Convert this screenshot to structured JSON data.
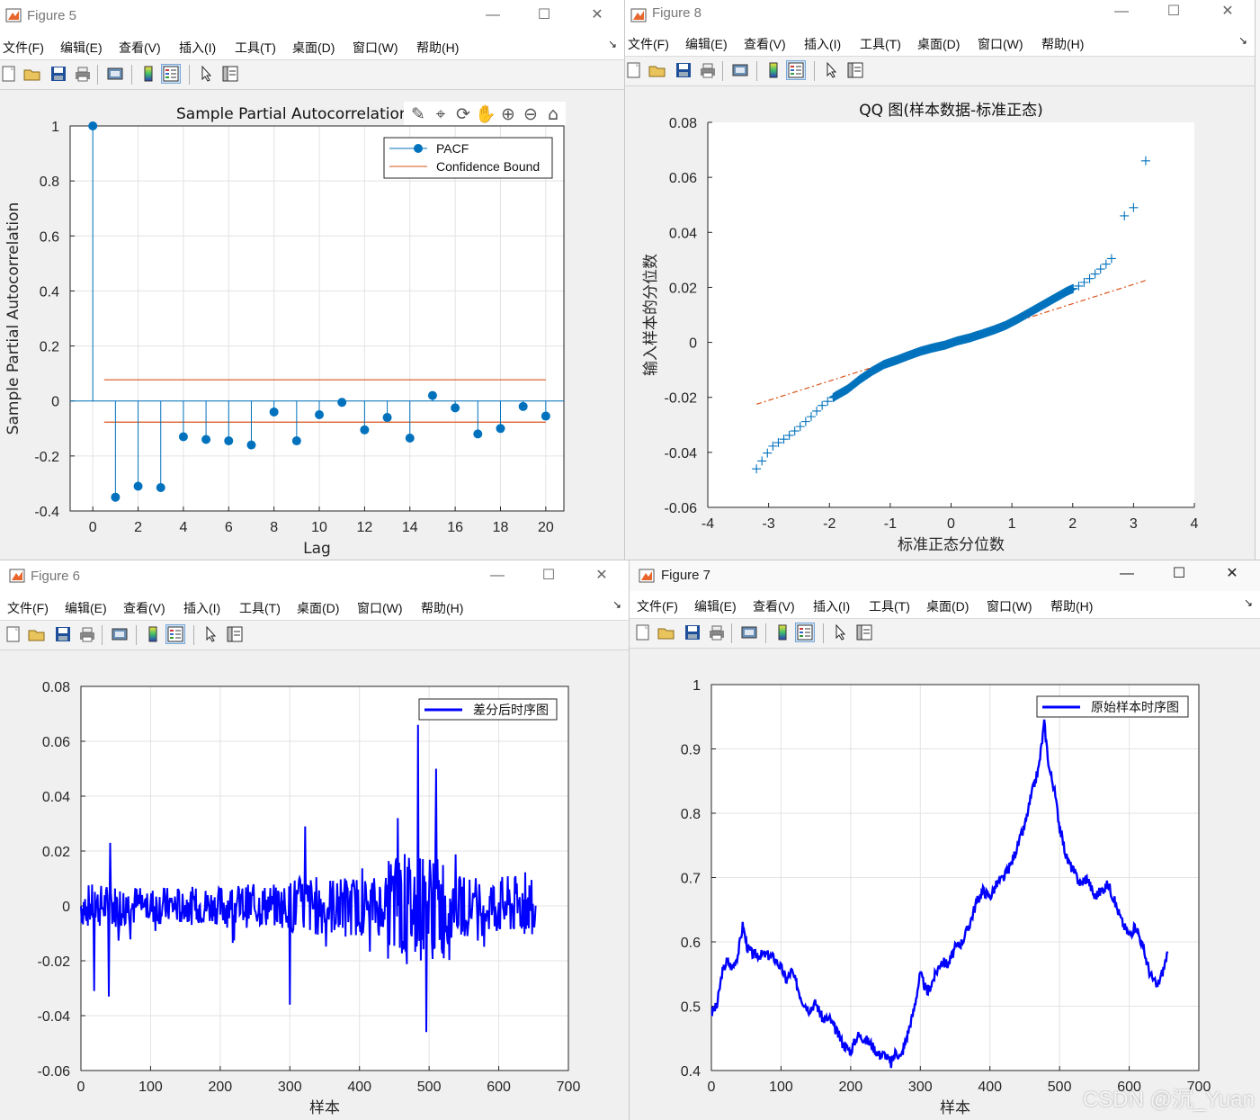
{
  "menu": [
    "文件(F)",
    "编辑(E)",
    "查看(V)",
    "插入(I)",
    "工具(T)",
    "桌面(D)",
    "窗口(W)",
    "帮助(H)"
  ],
  "window_controls": {
    "minimize": "—",
    "maximize": "☐",
    "close": "✕"
  },
  "watermark": "CSDN @沉_Yuan",
  "colors": {
    "stem": "#0072BD",
    "bound": "#D95319",
    "qq_marker": "#0072BD",
    "qq_line": "#D95319",
    "series": "#0000FF"
  },
  "icons": [
    "new-figure-icon",
    "open-icon",
    "save-icon",
    "print-icon",
    "print-preview-icon",
    "colorbar-icon",
    "legend-icon",
    "pointer-icon",
    "property-editor-icon"
  ],
  "figure5": {
    "title": "Figure 5",
    "axes_toolbar_icons": [
      "brush-icon",
      "data-tip-icon",
      "rotate-icon",
      "pan-icon",
      "zoom-in-icon",
      "zoom-out-icon",
      "home-icon"
    ],
    "chart_data": {
      "type": "stem",
      "title": "Sample Partial Autocorrelation F",
      "xlabel": "Lag",
      "ylabel": "Sample Partial Autocorrelation",
      "xlim": [
        -1,
        20.8
      ],
      "ylim": [
        -0.4,
        1
      ],
      "xticks": [
        "0",
        "2",
        "4",
        "6",
        "8",
        "10",
        "12",
        "14",
        "16",
        "18",
        "20"
      ],
      "yticks": [
        "1",
        "0.8",
        "0.6",
        "0.4",
        "0.2",
        "0",
        "-0.2",
        "-0.4"
      ],
      "grid": true,
      "legend": {
        "position": "top-right",
        "entries": [
          "PACF",
          "Confidence Bound"
        ]
      },
      "series": [
        {
          "name": "PACF",
          "x": [
            0,
            1,
            2,
            3,
            4,
            5,
            6,
            7,
            8,
            9,
            10,
            11,
            12,
            13,
            14,
            15,
            16,
            17,
            18,
            19,
            20
          ],
          "values": [
            1,
            -0.35,
            -0.31,
            -0.315,
            -0.13,
            -0.14,
            -0.145,
            -0.16,
            -0.04,
            -0.145,
            -0.05,
            -0.005,
            -0.105,
            -0.06,
            -0.135,
            0.02,
            -0.025,
            -0.12,
            -0.1,
            -0.02,
            -0.055
          ]
        },
        {
          "name": "Confidence Bound",
          "upper": 0.077,
          "lower": -0.077,
          "x_range": [
            0.5,
            20
          ]
        }
      ]
    }
  },
  "figure8": {
    "title": "Figure 8",
    "chart_data": {
      "type": "scatter",
      "title": "QQ 图(样本数据-标准正态)",
      "xlabel": "标准正态分位数",
      "ylabel": "输入样本的分位数",
      "xlim": [
        -4,
        4
      ],
      "ylim": [
        -0.06,
        0.08
      ],
      "xticks": [
        "-4",
        "-3",
        "-2",
        "-1",
        "0",
        "1",
        "2",
        "3",
        "4"
      ],
      "yticks": [
        "0.08",
        "0.06",
        "0.04",
        "0.02",
        "0",
        "-0.02",
        "-0.04",
        "-0.06"
      ],
      "grid": false,
      "reference_line": {
        "x": [
          -3.2,
          3.2
        ],
        "y": [
          -0.0225,
          0.0225
        ]
      },
      "quantile_curve": {
        "x": [
          -3.2,
          -2.95,
          -2.7,
          -2.5,
          -2.3,
          -2.1,
          -1.9,
          -1.7,
          -1.5,
          -1.3,
          -1.1,
          -0.9,
          -0.7,
          -0.5,
          -0.3,
          -0.1,
          0.1,
          0.3,
          0.5,
          0.7,
          0.9,
          1.1,
          1.3,
          1.5,
          1.7,
          1.9,
          2.1,
          2.3,
          2.5,
          2.6,
          2.7,
          2.85,
          3.2
        ],
        "y": [
          -0.046,
          -0.038,
          -0.0345,
          -0.031,
          -0.027,
          -0.0225,
          -0.0195,
          -0.017,
          -0.0135,
          -0.0105,
          -0.008,
          -0.0065,
          -0.0048,
          -0.0032,
          -0.002,
          -0.001,
          0.0005,
          0.0016,
          0.003,
          0.0045,
          0.0062,
          0.0085,
          0.011,
          0.0135,
          0.016,
          0.0185,
          0.0205,
          0.0235,
          0.0275,
          0.0295,
          0.032,
          0.046,
          0.066
        ],
        "extra_points": [
          {
            "x": 2.85,
            "y": 0.046
          },
          {
            "x": 3.0,
            "y": 0.049
          },
          {
            "x": 3.2,
            "y": 0.066
          }
        ]
      }
    }
  },
  "figure6": {
    "title": "Figure 6",
    "chart_data": {
      "type": "line",
      "xlabel": "样本",
      "ylabel": "",
      "xlim": [
        0,
        700
      ],
      "ylim": [
        -0.06,
        0.08
      ],
      "xticks": [
        "0",
        "100",
        "200",
        "300",
        "400",
        "500",
        "600",
        "700"
      ],
      "yticks": [
        "0.08",
        "0.06",
        "0.04",
        "0.02",
        "0",
        "-0.02",
        "-0.04",
        "-0.06"
      ],
      "grid": true,
      "legend": {
        "position": "top-right",
        "entries": [
          "差分后时序图"
        ]
      },
      "series": [
        {
          "name": "差分后时序图",
          "n": 654,
          "range": [
            -0.046,
            0.066
          ],
          "notable_points": [
            {
              "x": 19,
              "y": -0.031
            },
            {
              "x": 40,
              "y": -0.033
            },
            {
              "x": 42,
              "y": 0.023
            },
            {
              "x": 300,
              "y": -0.036
            },
            {
              "x": 322,
              "y": 0.029
            },
            {
              "x": 455,
              "y": 0.032
            },
            {
              "x": 484,
              "y": 0.066
            },
            {
              "x": 496,
              "y": -0.046
            },
            {
              "x": 510,
              "y": 0.05
            }
          ]
        }
      ]
    }
  },
  "figure7": {
    "title": "Figure 7",
    "chart_data": {
      "type": "line",
      "xlabel": "样本",
      "ylabel": "",
      "xlim": [
        0,
        700
      ],
      "ylim": [
        0.4,
        1
      ],
      "xticks": [
        "0",
        "100",
        "200",
        "300",
        "400",
        "500",
        "600",
        "700"
      ],
      "yticks": [
        "1",
        "0.9",
        "0.8",
        "0.7",
        "0.6",
        "0.5",
        "0.4"
      ],
      "grid": true,
      "legend": {
        "position": "top-right",
        "entries": [
          "原始样本时序图"
        ]
      },
      "series": [
        {
          "name": "原始样本时序图",
          "x": [
            0,
            8,
            15,
            22,
            30,
            38,
            45,
            52,
            60,
            70,
            80,
            90,
            100,
            108,
            115,
            122,
            130,
            140,
            150,
            160,
            170,
            180,
            190,
            200,
            210,
            220,
            230,
            240,
            250,
            258,
            265,
            272,
            280,
            290,
            300,
            310,
            320,
            330,
            340,
            350,
            360,
            370,
            380,
            390,
            400,
            410,
            420,
            430,
            440,
            450,
            460,
            470,
            478,
            485,
            492,
            500,
            510,
            520,
            530,
            540,
            550,
            560,
            570,
            580,
            590,
            600,
            610,
            620,
            630,
            640,
            650,
            655
          ],
          "y": [
            0.49,
            0.5,
            0.55,
            0.57,
            0.56,
            0.58,
            0.625,
            0.59,
            0.58,
            0.58,
            0.58,
            0.575,
            0.56,
            0.54,
            0.555,
            0.535,
            0.51,
            0.495,
            0.505,
            0.48,
            0.48,
            0.46,
            0.44,
            0.43,
            0.455,
            0.45,
            0.44,
            0.425,
            0.425,
            0.41,
            0.43,
            0.42,
            0.45,
            0.49,
            0.55,
            0.52,
            0.545,
            0.57,
            0.565,
            0.59,
            0.6,
            0.625,
            0.66,
            0.68,
            0.67,
            0.69,
            0.7,
            0.72,
            0.75,
            0.78,
            0.83,
            0.87,
            0.94,
            0.87,
            0.84,
            0.78,
            0.73,
            0.71,
            0.69,
            0.7,
            0.67,
            0.68,
            0.69,
            0.66,
            0.63,
            0.61,
            0.625,
            0.59,
            0.55,
            0.53,
            0.56,
            0.585
          ]
        }
      ]
    }
  }
}
